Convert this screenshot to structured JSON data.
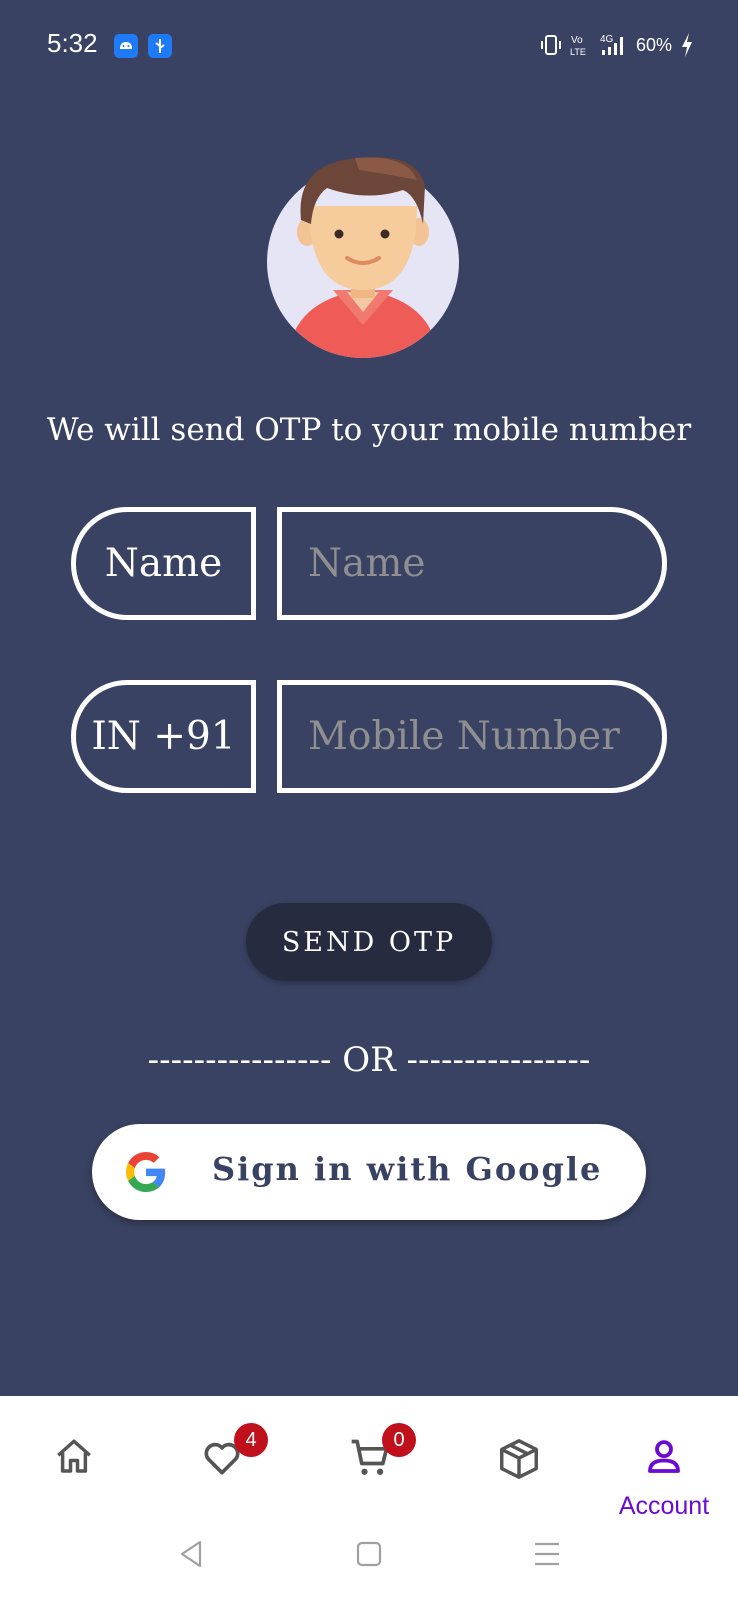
{
  "status_bar": {
    "time": "5:32",
    "network": "4G",
    "volte": "Vo LTE",
    "battery": "60%",
    "icons": [
      "android-notification-icon",
      "usb-icon",
      "vibrate-icon",
      "volte-icon",
      "signal-icon",
      "charging-icon"
    ]
  },
  "main": {
    "subtitle": "We will send OTP to your mobile number",
    "name_field": {
      "prefix_label": "Name",
      "placeholder": "Name",
      "value": ""
    },
    "mobile_field": {
      "prefix_label": "IN +91",
      "placeholder": "Mobile Number",
      "value": ""
    },
    "send_otp_label": "SEND OTP",
    "or_divider": "---------------- OR ----------------",
    "google_button_label": "Sign in with Google"
  },
  "bottom_nav": {
    "items": [
      {
        "icon": "home-icon"
      },
      {
        "icon": "heart-icon",
        "badge": "4"
      },
      {
        "icon": "cart-icon",
        "badge": "0"
      },
      {
        "icon": "box-icon"
      },
      {
        "icon": "account-icon",
        "label": "Account",
        "active": true
      }
    ],
    "active_color": "#6a0ad2",
    "badge_color": "#c0101c"
  },
  "colors": {
    "background": "#394262",
    "button_dark": "#262b3f",
    "placeholder": "#8f8f91"
  }
}
